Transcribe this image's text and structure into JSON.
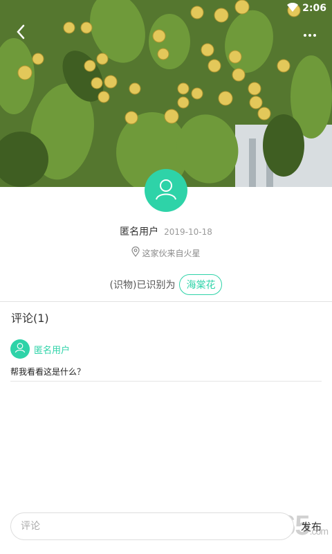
{
  "status_bar": {
    "time": "2:06"
  },
  "post": {
    "author": "匿名用户",
    "date": "2019-10-18",
    "location": "这家伙来自火星",
    "identified_prefix": "(识物)已识别为",
    "identified_result": "海棠花"
  },
  "comments": {
    "title": "评论(1)",
    "items": [
      {
        "author": "匿名用户",
        "text": "帮我看看这是什么？"
      }
    ]
  },
  "bottom_bar": {
    "placeholder": "评论",
    "send_label": "发布"
  },
  "watermark": {
    "text": "2265",
    "suffix": ".com"
  },
  "colors": {
    "accent": "#2ed3a8"
  },
  "icons": {
    "back": "chevron-left-icon",
    "more": "more-dots-icon",
    "wifi": "wifi-icon",
    "location": "location-pin-icon",
    "user": "user-avatar-icon"
  }
}
